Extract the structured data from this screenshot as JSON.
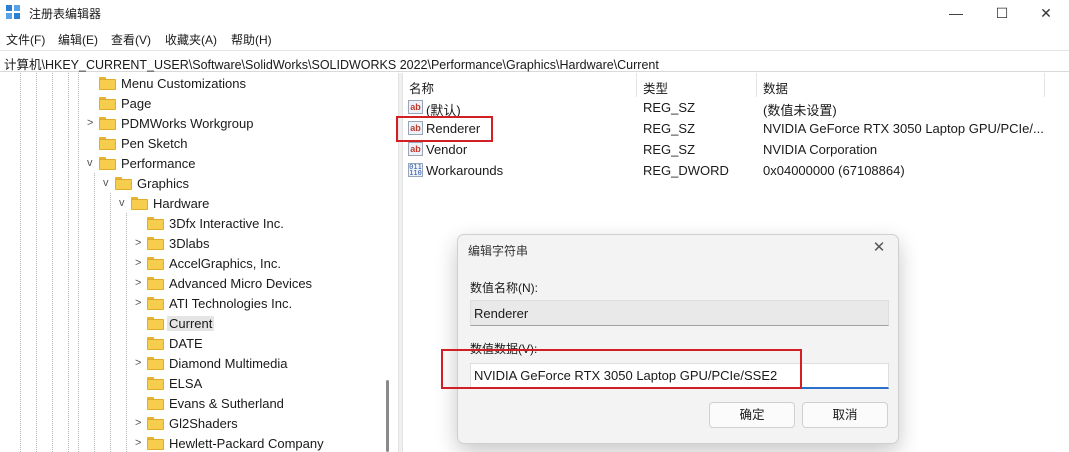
{
  "window": {
    "title": "注册表编辑器",
    "controls": {
      "minimize": "—",
      "maximize": "☐",
      "close": "✕"
    }
  },
  "menu": [
    "文件(F)",
    "编辑(E)",
    "查看(V)",
    "收藏夹(A)",
    "帮助(H)"
  ],
  "address": "计算机\\HKEY_CURRENT_USER\\Software\\SolidWorks\\SOLIDWORKS 2022\\Performance\\Graphics\\Hardware\\Current",
  "tree": {
    "items": [
      {
        "label": "Menu Customizations",
        "chevron": ""
      },
      {
        "label": "Page",
        "chevron": ""
      },
      {
        "label": "PDMWorks Workgroup",
        "chevron": ">"
      },
      {
        "label": "Pen Sketch",
        "chevron": ""
      },
      {
        "label": "Performance",
        "chevron": "v"
      },
      {
        "label": "Graphics",
        "chevron": "v"
      },
      {
        "label": "Hardware",
        "chevron": "v"
      },
      {
        "label": "3Dfx Interactive Inc.",
        "chevron": ""
      },
      {
        "label": "3Dlabs",
        "chevron": ">"
      },
      {
        "label": "AccelGraphics, Inc.",
        "chevron": ">"
      },
      {
        "label": "Advanced Micro Devices",
        "chevron": ">"
      },
      {
        "label": "ATI Technologies Inc.",
        "chevron": ">"
      },
      {
        "label": "Current",
        "chevron": "",
        "selected": true
      },
      {
        "label": "DATE",
        "chevron": ""
      },
      {
        "label": "Diamond Multimedia",
        "chevron": ">"
      },
      {
        "label": "ELSA",
        "chevron": ""
      },
      {
        "label": "Evans & Sutherland",
        "chevron": ""
      },
      {
        "label": "Gl2Shaders",
        "chevron": ">"
      },
      {
        "label": "Hewlett-Packard Company",
        "chevron": ">"
      }
    ]
  },
  "list": {
    "headers": {
      "name": "名称",
      "type": "类型",
      "data": "数据"
    },
    "rows": [
      {
        "icon": "string-value-icon",
        "icon_text": "ab",
        "name": "(默认)",
        "type": "REG_SZ",
        "data": "(数值未设置)"
      },
      {
        "icon": "string-value-icon",
        "icon_text": "ab",
        "name": "Renderer",
        "type": "REG_SZ",
        "data": "NVIDIA GeForce RTX 3050 Laptop GPU/PCIe/..."
      },
      {
        "icon": "string-value-icon",
        "icon_text": "ab",
        "name": "Vendor",
        "type": "REG_SZ",
        "data": "NVIDIA Corporation"
      },
      {
        "icon": "binary-value-icon",
        "icon_text": "011 110",
        "name": "Workarounds",
        "type": "REG_DWORD",
        "data": "0x04000000 (67108864)"
      }
    ]
  },
  "dialog": {
    "title": "编辑字符串",
    "close": "✕",
    "name_label": "数值名称(N):",
    "name_value": "Renderer",
    "data_label": "数值数据(V):",
    "data_value": "NVIDIA GeForce RTX 3050 Laptop GPU/PCIe/SSE2",
    "ok": "确定",
    "cancel": "取消"
  },
  "colors": {
    "highlight_box": "#d21f26",
    "folder": "#f7cd4d",
    "focus_underline": "#2a6fc9"
  }
}
